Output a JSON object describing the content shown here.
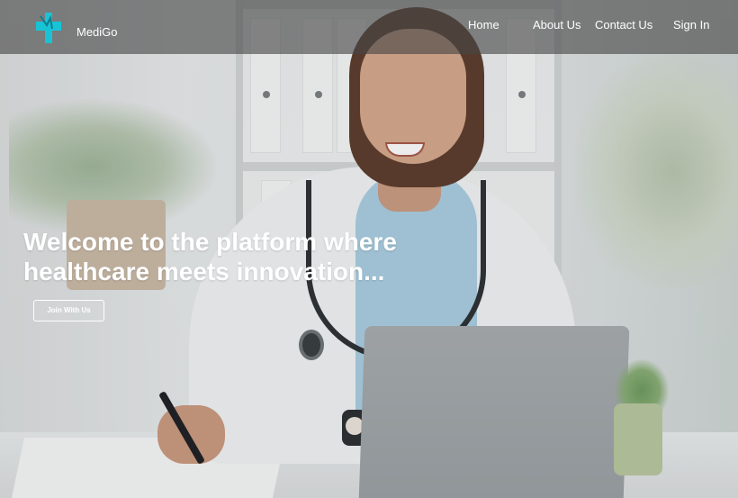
{
  "brand": {
    "name": "MediGo",
    "logo_icon": "medical-cross-logo",
    "logo_color": "#19c3d6"
  },
  "nav": {
    "items": [
      {
        "label": "Home"
      },
      {
        "label": "About Us"
      },
      {
        "label": "Contact Us"
      },
      {
        "label": "Sign In"
      }
    ]
  },
  "hero": {
    "headline_line1": "Welcome to the platform where",
    "headline_line2": "healthcare meets innovation...",
    "cta_label": "Join With Us"
  },
  "colors": {
    "nav_bg": "#464646",
    "text": "#ffffff"
  }
}
